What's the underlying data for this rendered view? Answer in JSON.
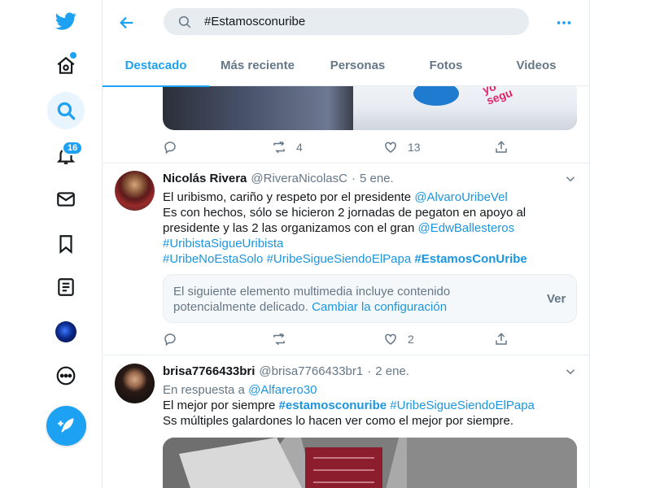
{
  "app": {
    "name": "Twitter"
  },
  "nav": {
    "notifications_badge": "16",
    "icons": [
      "twitter-logo",
      "home-icon",
      "explore-icon",
      "notifications-icon",
      "messages-icon",
      "bookmarks-icon",
      "lists-icon",
      "profile-avatar",
      "more-icon",
      "compose-tweet-icon"
    ]
  },
  "search": {
    "query": "#Estamosconuribe"
  },
  "tabs": [
    {
      "label": "Destacado",
      "active": true
    },
    {
      "label": "Más reciente",
      "active": false
    },
    {
      "label": "Personas",
      "active": false
    },
    {
      "label": "Fotos",
      "active": false
    },
    {
      "label": "Videos",
      "active": false
    }
  ],
  "tweet0": {
    "image_text": [
      "yo",
      "segu"
    ],
    "retweets": "4",
    "likes": "13"
  },
  "tweet1": {
    "name": "Nicolás Rivera",
    "handle": "@RiveraNicolasC",
    "sep": "·",
    "date": "5 ene.",
    "line1_text": "El uribismo, cariño y respeto por el presidente ",
    "line1_link": "@AlvaroUribeVel",
    "line2_text": "Es con hechos, sólo se hicieron 2 jornadas de pegaton en apoyo al presidente y las 2 las organizamos con el gran ",
    "line2_link": "@EdwBallesteros",
    "hashtag1": "#UribistaSigueUribista",
    "hashtag2": "#UribeNoEstaSolo",
    "hashtag3": "#UribeSigueSiendoElPapa",
    "hashtag4": "#EstamosConUribe",
    "sensitive_text": "El siguiente elemento multimedia incluye contenido potencialmente delicado.",
    "sensitive_link": "Cambiar la configuración",
    "sensitive_button": "Ver",
    "likes": "2"
  },
  "tweet2": {
    "name": "brisa7766433bri",
    "handle": "@brisa7766433br1",
    "sep": "·",
    "date": "2 ene.",
    "reply_prefix": "En respuesta a ",
    "reply_to": "@Alfarero30",
    "text1": "El mejor por siempre ",
    "hashtag1": "#estamosconuribe",
    "hashtag2": "#UribeSigueSiendoElPapa",
    "text2": "Ss múltiples galardones lo hacen ver como el mejor por siempre."
  },
  "colors": {
    "accent": "#1da1f2",
    "link": "#1b95e0",
    "muted": "#657786",
    "border": "#e6ecf0"
  }
}
